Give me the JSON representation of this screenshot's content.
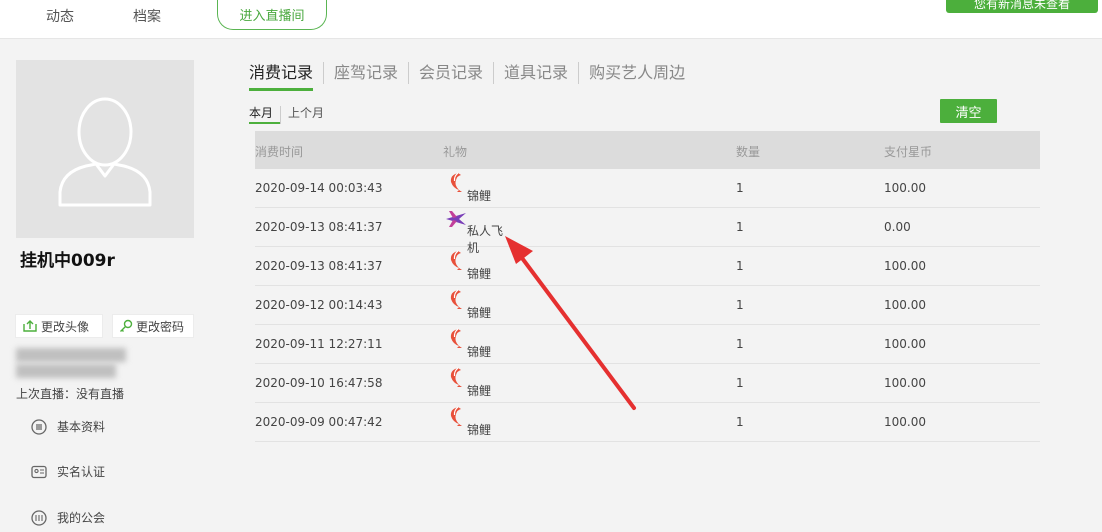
{
  "nav": {
    "items": [
      "动态",
      "档案"
    ],
    "live_button": "进入直播间",
    "message_button": "您有新消息未查看"
  },
  "profile": {
    "username": "挂机中009r",
    "change_avatar": "更改头像",
    "change_password": "更改密码",
    "last_live": "上次直播：没有直播",
    "links": [
      "基本资料",
      "实名认证",
      "我的公会"
    ]
  },
  "tabs": [
    "消费记录",
    "座驾记录",
    "会员记录",
    "道具记录",
    "购买艺人周边"
  ],
  "subtabs": [
    "本月",
    "上个月"
  ],
  "clear_button": "清空",
  "table": {
    "headers": [
      "消费时间",
      "礼物",
      "数量",
      "支付星币"
    ],
    "rows": [
      {
        "time": "2020-09-14 00:03:43",
        "gift": "锦鲤",
        "qty": "1",
        "amount": "100.00",
        "icon": "koi-icon"
      },
      {
        "time": "2020-09-13 08:41:37",
        "gift": "私人飞机",
        "qty": "1",
        "amount": "0.00",
        "icon": "plane-icon"
      },
      {
        "time": "2020-09-13 08:41:37",
        "gift": "锦鲤",
        "qty": "1",
        "amount": "100.00",
        "icon": "koi-icon"
      },
      {
        "time": "2020-09-12 00:14:43",
        "gift": "锦鲤",
        "qty": "1",
        "amount": "100.00",
        "icon": "koi-icon"
      },
      {
        "time": "2020-09-11 12:27:11",
        "gift": "锦鲤",
        "qty": "1",
        "amount": "100.00",
        "icon": "koi-icon"
      },
      {
        "time": "2020-09-10 16:47:58",
        "gift": "锦鲤",
        "qty": "1",
        "amount": "100.00",
        "icon": "koi-icon"
      },
      {
        "time": "2020-09-09 00:47:42",
        "gift": "锦鲤",
        "qty": "1",
        "amount": "100.00",
        "icon": "koi-icon"
      }
    ]
  },
  "colors": {
    "accent": "#4caf3c",
    "annotation_arrow": "#e53030"
  }
}
